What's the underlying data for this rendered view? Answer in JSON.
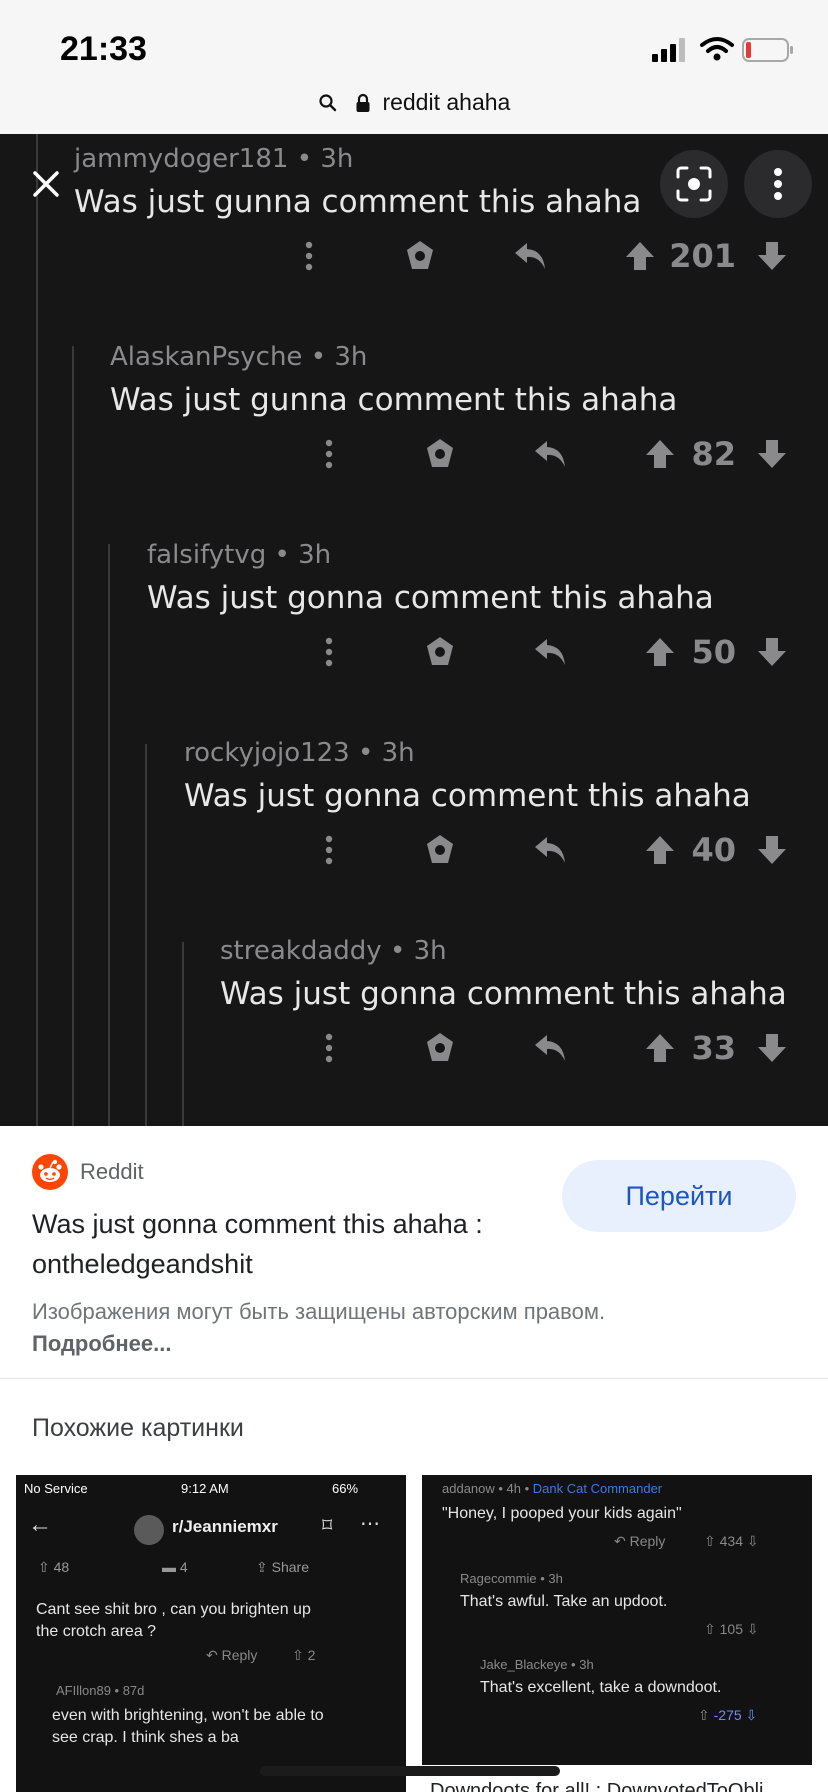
{
  "status": {
    "time": "21:33"
  },
  "browser": {
    "url_text": "reddit ahaha"
  },
  "thread": [
    {
      "author": "jammydoger181",
      "age": "3h",
      "text": "Was just gunna comment this ahaha",
      "score": "201"
    },
    {
      "author": "AlaskanPsyche",
      "age": "3h",
      "text": "Was just gunna comment this ahaha",
      "score": "82"
    },
    {
      "author": "falsifytvg",
      "age": "3h",
      "text": "Was just gonna comment this ahaha",
      "score": "50"
    },
    {
      "author": "rockyjojo123",
      "age": "3h",
      "text": "Was just gonna comment this ahaha",
      "score": "40"
    },
    {
      "author": "streakdaddy",
      "age": "3h",
      "text": "Was just gonna comment this ahaha",
      "score": "33"
    }
  ],
  "meta_sep": "•",
  "info": {
    "source": "Reddit",
    "title": "Was just gonna comment this ahaha : ontheledgeandshit",
    "goto_label": "Перейти",
    "copyright_text": "Изображения могут быть защищены авторским правом.",
    "more_link": "Подробнее..."
  },
  "similar": {
    "heading": "Похожие картинки",
    "thumb1": {
      "no_service": "No Service",
      "time": "9:12 AM",
      "battery": "66%",
      "subreddit": "r/Jeanniemxr",
      "votes": "48",
      "comments": "4",
      "share": "Share",
      "comment1": "Cant see shit bro , can you brighten up",
      "comment1b": "the crotch area ?",
      "reply": "Reply",
      "c1_score": "2",
      "author2": "AFIllon89 • 87d",
      "comment2": "even with brightening, won't be able to",
      "comment2b": "see crap. I think shes a ba"
    },
    "thumb2": {
      "author1": "addanow • 4h •",
      "flair": "Dank Cat Commander",
      "comment1": "\"Honey, I pooped your kids again\"",
      "reply": "Reply",
      "score1": "434",
      "author2": "Ragecommie • 3h",
      "comment2": "That's awful. Take an updoot.",
      "score2": "105",
      "author3": "Jake_Blackeye • 3h",
      "comment3": "That's excellent, take a downdoot.",
      "score3": "-275"
    },
    "thumb2_caption": "Downdoots for all! : DownvotedToObli"
  },
  "colors": {
    "dark_bg": "#161617",
    "thread_line": "#3a3a3c",
    "goto_bg": "#e8f0fe",
    "goto_text": "#1a56c4",
    "reddit_orange": "#ff4500"
  }
}
